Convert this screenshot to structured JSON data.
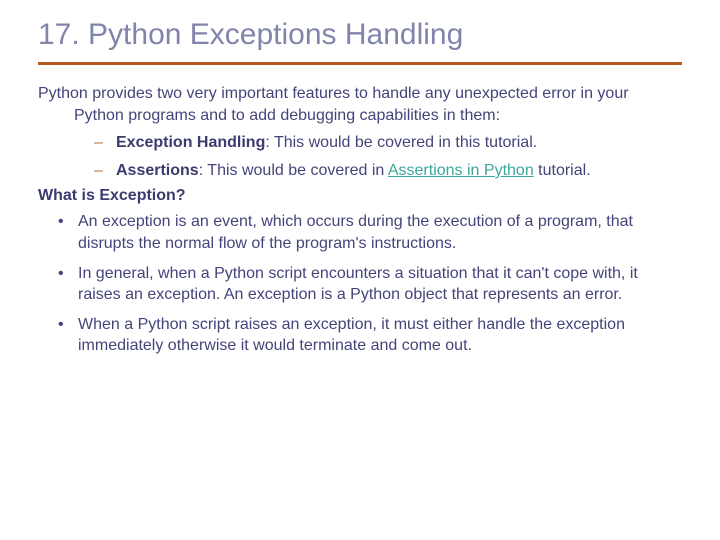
{
  "title": "17. Python Exceptions Handling",
  "intro": "Python provides two very important features to handle any unexpected error in your Python programs and to add debugging capabilities in them:",
  "sub": {
    "item1_bold": "Exception Handling",
    "item1_rest": ": This would be covered in this tutorial.",
    "item2_bold": "Assertions",
    "item2_mid": ": This would be covered in ",
    "item2_link": "Assertions in Python",
    "item2_end": " tutorial."
  },
  "subhead": "What is Exception?",
  "bullets": {
    "b1": "An exception is an event, which occurs during the execution of a program, that disrupts the normal flow of the program's instructions.",
    "b2": "In general, when a Python script encounters a situation that it can't cope with, it raises an exception. An exception is a Python object that represents an error.",
    "b3": "When a Python script raises an exception, it must either handle the exception immediately otherwise it would terminate and come out."
  }
}
